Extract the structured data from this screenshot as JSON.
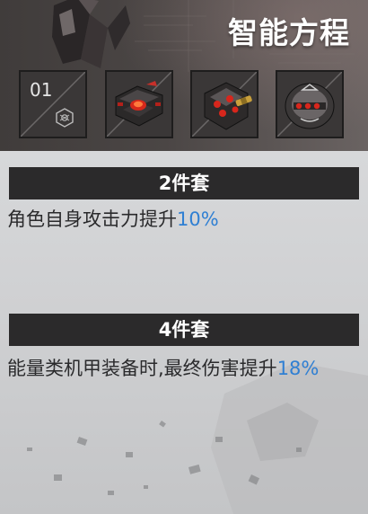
{
  "header": {
    "title": "智能方程",
    "art_icon": "mech-silhouette-icon"
  },
  "slots": [
    {
      "type": "empty",
      "number": "01",
      "icon": "hex-emblem-icon"
    },
    {
      "type": "item",
      "icon": "mech-module-red-core-icon"
    },
    {
      "type": "item",
      "icon": "mech-module-gold-barrel-icon"
    },
    {
      "type": "item",
      "icon": "mech-module-round-icon"
    }
  ],
  "set_bonuses": [
    {
      "label": "2件套",
      "text": "角色自身攻击力提升",
      "value": "10%"
    },
    {
      "label": "4件套",
      "text": "能量类机甲装备时,最终伤害提升",
      "value": "18%"
    }
  ],
  "colors": {
    "highlight": "#2f7fd3",
    "bar": "#2b2a2b",
    "header": "#4b4645"
  }
}
